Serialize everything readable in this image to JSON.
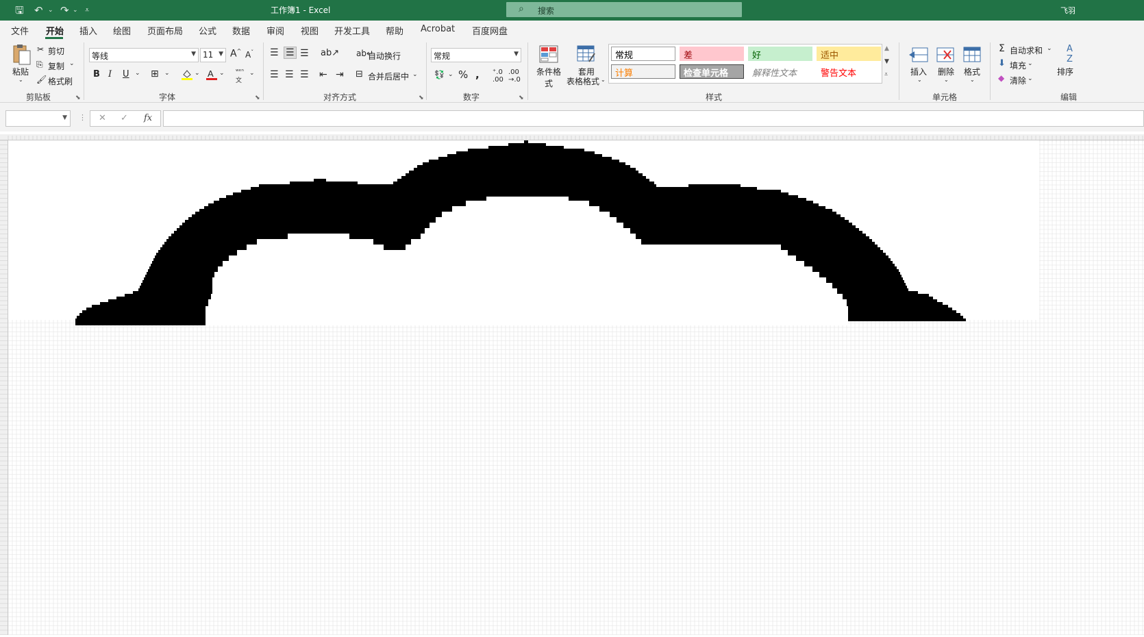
{
  "titlebar": {
    "title": "工作簿1  -  Excel",
    "search_placeholder": "搜索",
    "user": "飞羽"
  },
  "tabs": [
    "文件",
    "开始",
    "插入",
    "绘图",
    "页面布局",
    "公式",
    "数据",
    "审阅",
    "视图",
    "开发工具",
    "帮助",
    "Acrobat",
    "百度网盘"
  ],
  "active_tab": "开始",
  "ribbon": {
    "clipboard": {
      "paste": "粘贴",
      "cut": "剪切",
      "copy": "复制",
      "format_painter": "格式刷",
      "label": "剪贴板"
    },
    "font": {
      "name": "等线",
      "size": "11",
      "bold": "B",
      "italic": "I",
      "underline": "U",
      "label": "字体"
    },
    "alignment": {
      "wrap": "自动换行",
      "merge": "合并后居中",
      "label": "对齐方式"
    },
    "number": {
      "format": "常规",
      "label": "数字"
    },
    "styles": {
      "conditional": "条件格式",
      "table_line1": "套用",
      "table_line2": "表格格式",
      "cells": [
        {
          "text": "常规",
          "bg": "#ffffff",
          "fg": "#000000",
          "border": "#9c9c9c"
        },
        {
          "text": "差",
          "bg": "#ffc7ce",
          "fg": "#9c0006",
          "border": "#ffc7ce"
        },
        {
          "text": "好",
          "bg": "#c6efce",
          "fg": "#006100",
          "border": "#c6efce"
        },
        {
          "text": "适中",
          "bg": "#ffeb9c",
          "fg": "#9c5700",
          "border": "#ffeb9c"
        },
        {
          "text": "计算",
          "bg": "#f2f2f2",
          "fg": "#fa7d00",
          "border": "#7f7f7f"
        },
        {
          "text": "检查单元格",
          "bg": "#a5a5a5",
          "fg": "#ffffff",
          "border": "#3f3f3f"
        },
        {
          "text": "解释性文本",
          "bg": "#ffffff",
          "fg": "#7f7f7f",
          "border": "#ffffff"
        },
        {
          "text": "警告文本",
          "bg": "#ffffff",
          "fg": "#ff0000",
          "border": "#ffffff"
        }
      ],
      "label": "样式"
    },
    "cells": {
      "insert": "插入",
      "delete": "删除",
      "format": "格式",
      "label": "单元格"
    },
    "editing": {
      "autosum": "自动求和",
      "fill": "填充",
      "clear": "清除",
      "sort": "排序",
      "label": "编辑"
    }
  },
  "formula_bar": {
    "fx": "fx"
  },
  "colors": {
    "accent": "#217346",
    "fill": "#000000"
  },
  "drawing": {
    "description_rows": "black filled cell rows forming an arch shape",
    "rows": [
      [
        205,
        209,
        765,
        771
      ],
      [
        209,
        213,
        742,
        797
      ],
      [
        213,
        217,
        713,
        823
      ],
      [
        217,
        221,
        683,
        853
      ],
      [
        221,
        225,
        666,
        868
      ],
      [
        225,
        229,
        653,
        879
      ],
      [
        229,
        233,
        640,
        893
      ],
      [
        233,
        237,
        626,
        904
      ],
      [
        237,
        241,
        617,
        913
      ],
      [
        241,
        245,
        609,
        920
      ],
      [
        245,
        249,
        604,
        928
      ],
      [
        249,
        253,
        597,
        932
      ],
      [
        253,
        257,
        592,
        938
      ],
      [
        257,
        261,
        586,
        943
      ],
      [
        261,
        265,
        458,
        476
      ],
      [
        261,
        265,
        580,
        948
      ],
      [
        265,
        269,
        423,
        522
      ],
      [
        265,
        269,
        574,
        955
      ],
      [
        269,
        273,
        1005,
        1081
      ],
      [
        269,
        273,
        378,
        958
      ],
      [
        273,
        277,
        1005,
        1105
      ],
      [
        273,
        277,
        366,
        1105
      ],
      [
        277,
        281,
        352,
        1140
      ],
      [
        281,
        285,
        340,
        1151
      ],
      [
        285,
        289,
        330,
        1165
      ],
      [
        289,
        293,
        320,
        1177
      ],
      [
        293,
        297,
        312,
        1187
      ],
      [
        297,
        301,
        304,
        1195
      ],
      [
        301,
        305,
        298,
        1205
      ],
      [
        305,
        309,
        291,
        1215
      ],
      [
        309,
        313,
        285,
        1221
      ],
      [
        313,
        317,
        280,
        1227
      ],
      [
        317,
        321,
        275,
        1233
      ],
      [
        321,
        325,
        270,
        1239
      ],
      [
        325,
        329,
        266,
        1244
      ],
      [
        329,
        333,
        262,
        1249
      ],
      [
        333,
        337,
        258,
        1254
      ],
      [
        337,
        341,
        254,
        1259
      ],
      [
        341,
        345,
        250,
        1264
      ],
      [
        345,
        349,
        246,
        1269
      ],
      [
        349,
        353,
        243,
        1273
      ],
      [
        353,
        357,
        240,
        1277
      ],
      [
        357,
        361,
        237,
        1281
      ],
      [
        361,
        365,
        234,
        1285
      ],
      [
        365,
        369,
        231,
        1289
      ],
      [
        369,
        373,
        228,
        1293
      ],
      [
        373,
        377,
        226,
        1297
      ],
      [
        377,
        381,
        224,
        1300
      ],
      [
        381,
        385,
        222,
        1303
      ],
      [
        385,
        389,
        220,
        1306
      ],
      [
        389,
        393,
        218,
        1309
      ],
      [
        393,
        397,
        216,
        1312
      ],
      [
        397,
        401,
        214,
        1314
      ],
      [
        401,
        405,
        212,
        1316
      ],
      [
        405,
        409,
        210,
        1318
      ],
      [
        409,
        413,
        208,
        1320
      ],
      [
        413,
        417,
        206,
        1322
      ],
      [
        417,
        421,
        204,
        1324
      ],
      [
        421,
        425,
        202,
        1326
      ],
      [
        425,
        429,
        194,
        1340
      ],
      [
        429,
        433,
        182,
        1356
      ],
      [
        433,
        437,
        170,
        1362
      ],
      [
        437,
        441,
        158,
        1368
      ],
      [
        441,
        445,
        146,
        1376
      ],
      [
        445,
        449,
        134,
        1384
      ],
      [
        449,
        453,
        126,
        1390
      ],
      [
        453,
        457,
        120,
        1396
      ],
      [
        457,
        461,
        116,
        1402
      ],
      [
        461,
        465,
        112,
        1406
      ],
      [
        465,
        469,
        110,
        1410
      ],
      [
        469,
        475,
        110,
        300
      ]
    ],
    "holes": [
      [
        287,
        293,
        710,
        830
      ],
      [
        293,
        301,
        680,
        860
      ],
      [
        301,
        309,
        660,
        875
      ],
      [
        309,
        317,
        645,
        890
      ],
      [
        317,
        325,
        636,
        900
      ],
      [
        325,
        333,
        627,
        910
      ],
      [
        333,
        341,
        620,
        920
      ],
      [
        341,
        349,
        420,
        510,
        614,
        928
      ],
      [
        349,
        357,
        375,
        545,
        600,
        936
      ],
      [
        357,
        365,
        360,
        560,
        592,
        1140
      ],
      [
        365,
        373,
        346,
        1150
      ],
      [
        373,
        381,
        334,
        1162
      ],
      [
        381,
        389,
        325,
        1174
      ],
      [
        389,
        397,
        318,
        1186
      ],
      [
        397,
        405,
        313,
        1196
      ],
      [
        405,
        413,
        310,
        1206
      ],
      [
        413,
        421,
        310,
        1215
      ],
      [
        421,
        429,
        310,
        1222
      ],
      [
        429,
        437,
        308,
        1230
      ],
      [
        437,
        447,
        304,
        1236
      ],
      [
        447,
        475,
        300,
        1238
      ]
    ]
  }
}
